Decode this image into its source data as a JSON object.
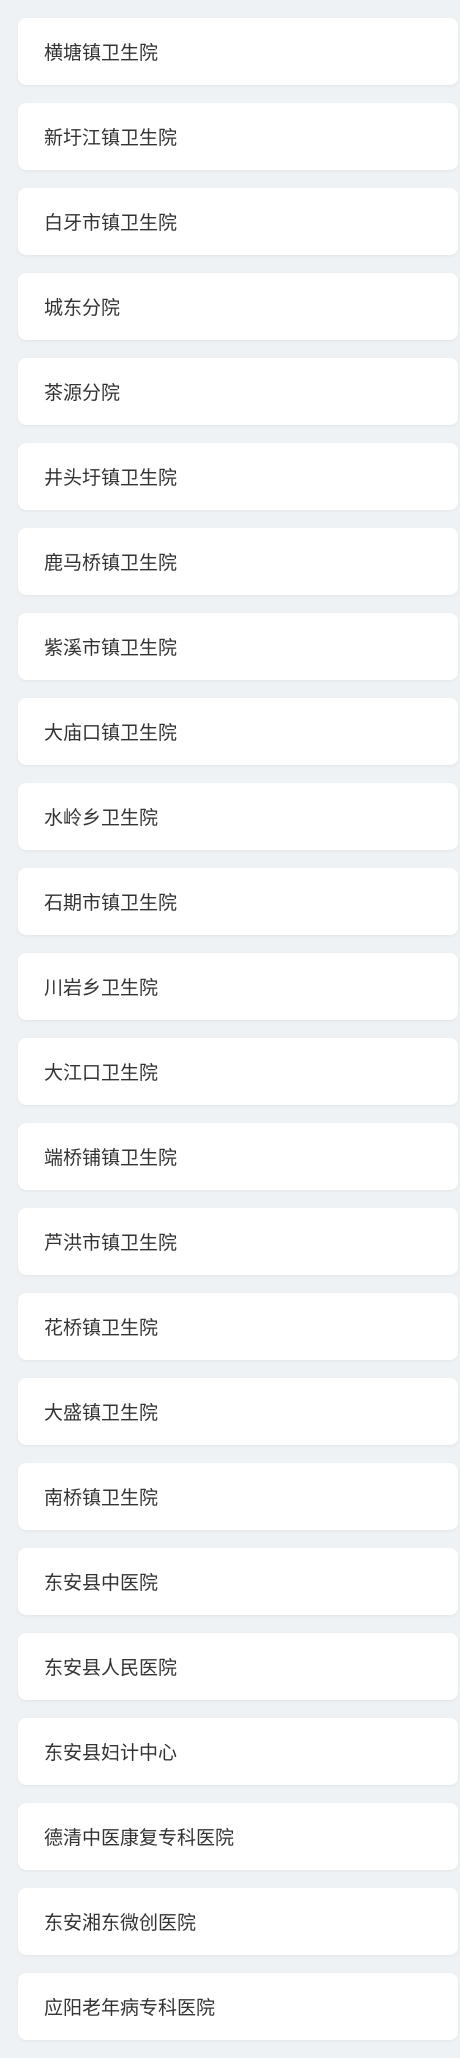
{
  "hospitals": [
    {
      "name": "横塘镇卫生院"
    },
    {
      "name": "新圩江镇卫生院"
    },
    {
      "name": "白牙市镇卫生院"
    },
    {
      "name": "城东分院"
    },
    {
      "name": "茶源分院"
    },
    {
      "name": "井头圩镇卫生院"
    },
    {
      "name": "鹿马桥镇卫生院"
    },
    {
      "name": "紫溪市镇卫生院"
    },
    {
      "name": "大庙口镇卫生院"
    },
    {
      "name": "水岭乡卫生院"
    },
    {
      "name": "石期市镇卫生院"
    },
    {
      "name": "川岩乡卫生院"
    },
    {
      "name": "大江口卫生院"
    },
    {
      "name": "端桥铺镇卫生院"
    },
    {
      "name": "芦洪市镇卫生院"
    },
    {
      "name": "花桥镇卫生院"
    },
    {
      "name": "大盛镇卫生院"
    },
    {
      "name": "南桥镇卫生院"
    },
    {
      "name": "东安县中医院"
    },
    {
      "name": "东安县人民医院"
    },
    {
      "name": "东安县妇计中心"
    },
    {
      "name": "德清中医康复专科医院"
    },
    {
      "name": "东安湘东微创医院"
    },
    {
      "name": "应阳老年病专科医院"
    }
  ]
}
